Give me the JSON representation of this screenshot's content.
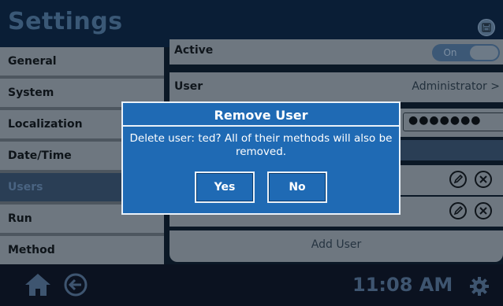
{
  "header": {
    "title": "Settings"
  },
  "sidebar": {
    "items": [
      {
        "label": "General"
      },
      {
        "label": "System"
      },
      {
        "label": "Localization"
      },
      {
        "label": "Date/Time"
      },
      {
        "label": "Users",
        "active": true
      },
      {
        "label": "Run"
      },
      {
        "label": "Method"
      }
    ]
  },
  "user_form": {
    "active_label": "Active",
    "active_toggle_value": "On",
    "user_label": "User",
    "user_value": "Administrator >",
    "password_mask": "●●●●●●●"
  },
  "users_list": {
    "add_user_label": "Add User"
  },
  "footer": {
    "time": "11:08 AM"
  },
  "dialog": {
    "title": "Remove User",
    "message": "Delete user: ted? All of their methods will also be removed.",
    "yes_label": "Yes",
    "no_label": "No"
  },
  "colors": {
    "dialog_bg": "#1f6ab4",
    "panel_gray": "#6e7780",
    "header_bg": "#0a1e36",
    "active_item": "#2a3e55"
  },
  "icons": {
    "save": "save-icon",
    "home": "home-icon",
    "back": "back-icon",
    "edit": "edit-icon",
    "delete": "delete-icon",
    "settings": "gear-icon"
  }
}
